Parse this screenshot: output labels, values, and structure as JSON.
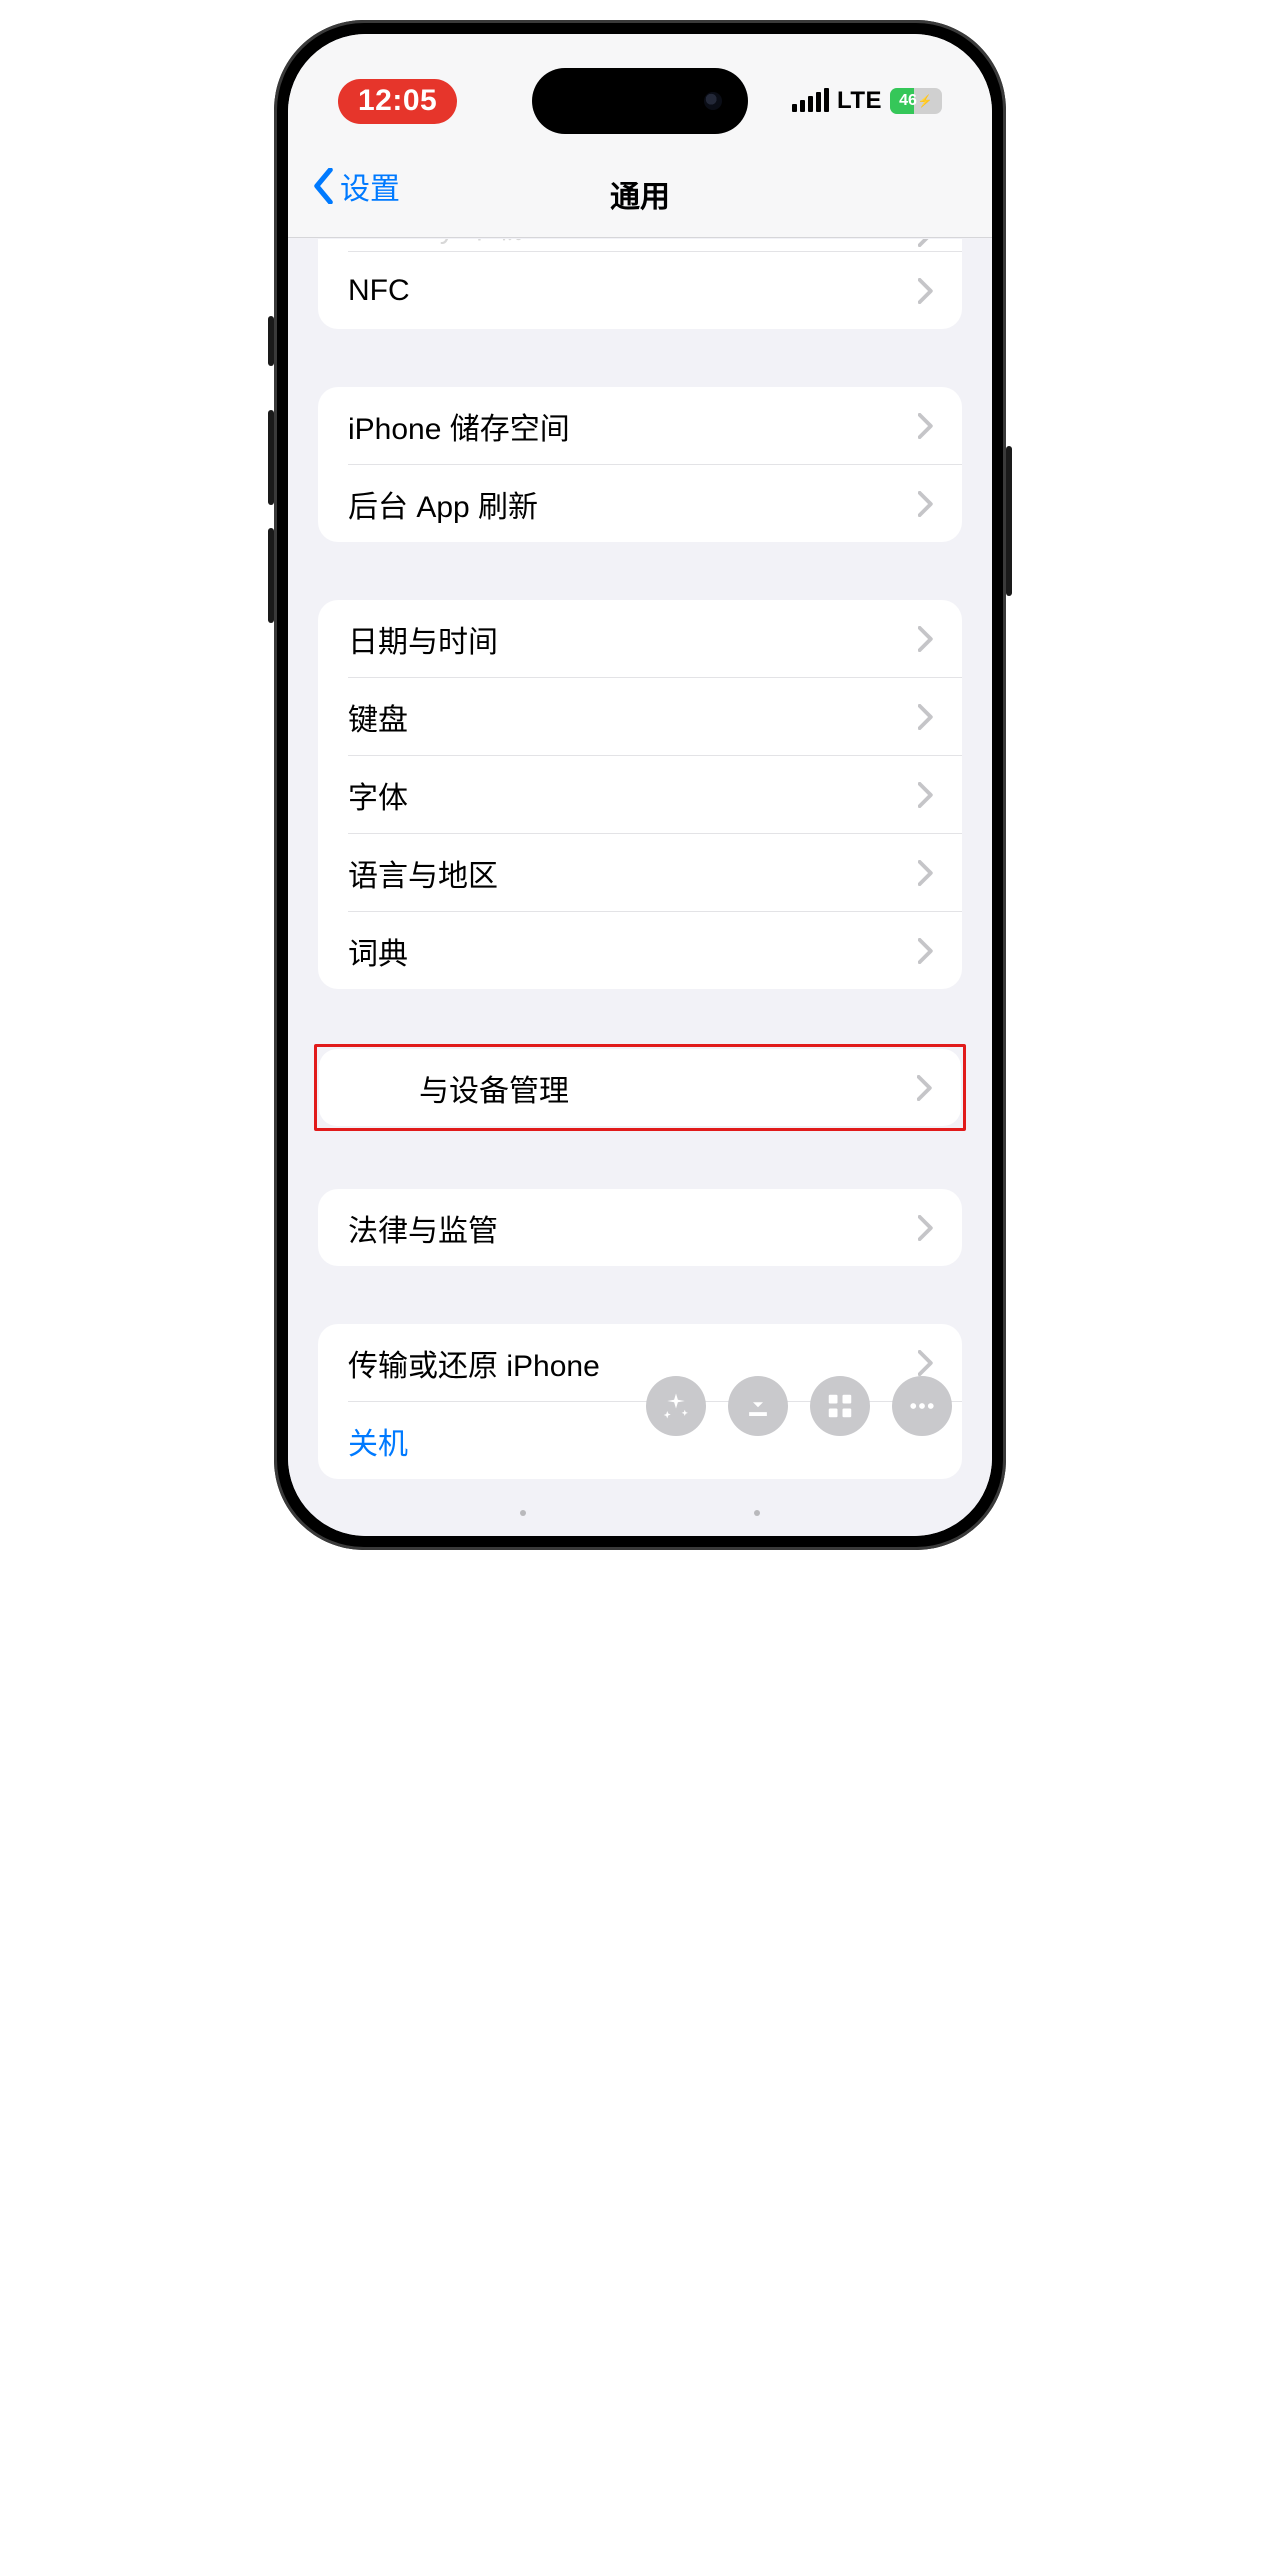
{
  "status": {
    "time": "12:05",
    "network_label": "LTE",
    "battery_percent": "46"
  },
  "nav": {
    "back_label": "设置",
    "title": "通用"
  },
  "groups": {
    "g0": {
      "carplay_partial": "CarPlay 车载",
      "nfc": "NFC"
    },
    "g1": {
      "storage": "iPhone 储存空间",
      "bg_refresh": "后台 App 刷新"
    },
    "g2": {
      "datetime": "日期与时间",
      "keyboard": "键盘",
      "fonts": "字体",
      "lang": "语言与地区",
      "dict": "词典"
    },
    "g3": {
      "vpn_suffix": "与设备管理"
    },
    "g4": {
      "legal": "法律与监管"
    },
    "g5": {
      "transfer": "传输或还原 iPhone",
      "shutdown": "关机"
    }
  }
}
